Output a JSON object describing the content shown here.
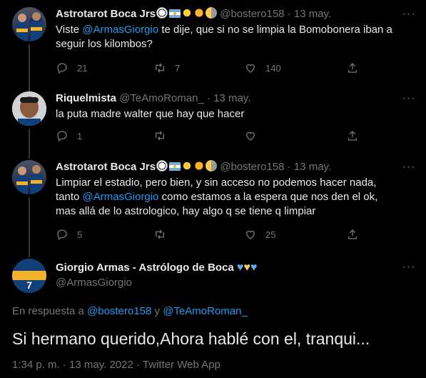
{
  "tweets": [
    {
      "name": "Astrotarot Boca Jrs",
      "handle": "@bostero158",
      "dot": "·",
      "time": "13 may.",
      "text_parts": [
        "Viste ",
        "@ArmasGiorgio",
        " te dije, que si no se limpia la Bomobonera iban a seguir los kilombos?"
      ],
      "replies": "21",
      "retweets": "7",
      "likes": "140"
    },
    {
      "name": "Riquelmista",
      "handle": "@TeAmoRoman_",
      "dot": "·",
      "time": "13 may.",
      "text": "la puta madre walter que hay que hacer",
      "replies": "1",
      "retweets": "",
      "likes": ""
    },
    {
      "name": "Astrotarot Boca Jrs",
      "handle": "@bostero158",
      "dot": "·",
      "time": "13 may.",
      "text_parts": [
        "Limpiar el estadio, pero bien, y sin acceso no podemos hacer nada, tanto ",
        "@ArmasGiorgio",
        " como estamos a la espera que nos den el ok, mas allá de lo astrologico, hay algo q se tiene q limpiar"
      ],
      "replies": "5",
      "retweets": "",
      "likes": "25"
    }
  ],
  "main": {
    "name": "Giorgio Armas - Astrólogo de Boca",
    "handle": "@ArmasGiorgio",
    "reply_prefix": "En respuesta a",
    "reply_user1": "@bostero158",
    "reply_and": "y",
    "reply_user2": "@TeAmoRoman_",
    "text": "Si hermano querido,Ahora hablé con el, tranqui...",
    "time": "1:34 p. m.",
    "sep1": "·",
    "date": "13 may. 2022",
    "sep2": "·",
    "source": "Twitter Web App"
  },
  "more_glyph": "···",
  "colors": {
    "background": "#000000",
    "text": "#e7e9ea",
    "muted": "#71767b",
    "link": "#1d9bf0",
    "boca_blue": "#103f79",
    "boca_yellow": "#f3b229"
  }
}
